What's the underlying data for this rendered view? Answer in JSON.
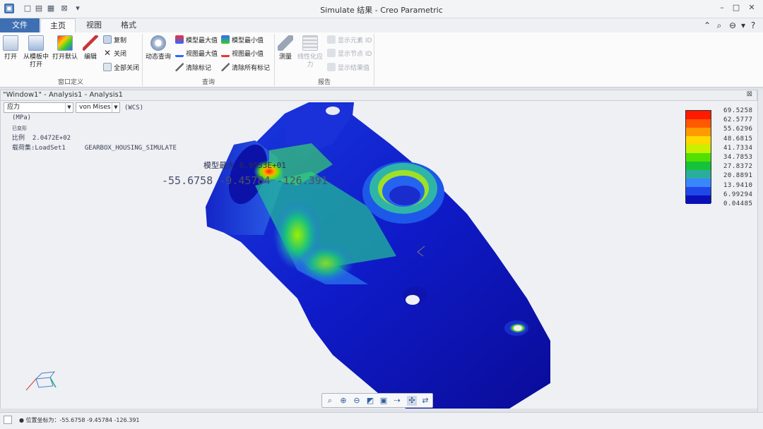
{
  "window": {
    "title": "Simulate 结果 - Creo Parametric"
  },
  "quick_access": [
    "app-icon",
    "new-icon",
    "open-icon",
    "save-icon",
    "print-icon",
    "close-window-icon",
    "customize-icon"
  ],
  "tabs": [
    {
      "label": "文件"
    },
    {
      "label": "主页"
    },
    {
      "label": "视图"
    },
    {
      "label": "格式"
    }
  ],
  "ribbon": {
    "window_group": {
      "open": "打开",
      "open_from_template": "从模板中打开",
      "open_default": "打开默认",
      "edit": "编辑",
      "copy": "复制",
      "close": "关闭",
      "close_all": "全部关闭",
      "label": "窗口定义"
    },
    "query_group": {
      "dynamic_query": "动态查询",
      "model_max": "模型最大值",
      "model_min": "模型最小值",
      "view_max": "视图最大值",
      "view_min": "视图最小值",
      "clear_marks": "清除标记",
      "clear_all_marks": "清除所有标记",
      "label": "查询"
    },
    "report_group": {
      "measure": "测量",
      "linearize": "线性化应力",
      "show_element_id": "显示元素 ID",
      "show_node_id": "显示节点 ID",
      "show_result_value": "显示结果值",
      "label": "报告"
    }
  },
  "subwindow": {
    "title": "\"Window1\" - Analysis1 - Analysis1"
  },
  "result_controls": {
    "quantity": "应力",
    "component": "von Mises",
    "coord_system": "(WCS)"
  },
  "info": {
    "units": "(MPa)",
    "deformed": "已变形",
    "scale_label": "比例",
    "scale_value": "2.0472E+02",
    "loadset_label": "载荷集:",
    "loadset_value": "LoadSet1",
    "model_name": "GEARBOX_HOUSING_SIMULATE"
  },
  "query_readout": {
    "label": "模型最大",
    "value": "6.9553E+01",
    "coords": "-55.6758  -9.45784  -126.391"
  },
  "legend": {
    "values": [
      "69.5258",
      "62.5777",
      "55.6296",
      "48.6815",
      "41.7334",
      "34.7853",
      "27.8372",
      "20.8891",
      "13.9410",
      "6.99294",
      "0.04485"
    ],
    "colors": [
      "#ff1a00",
      "#ff5a00",
      "#ff9a00",
      "#ffd800",
      "#c8f000",
      "#52e000",
      "#16c23a",
      "#2aae9c",
      "#3a86ff",
      "#1f48e8",
      "#0b0fb8"
    ]
  },
  "zoom_toolbar": [
    "refit-icon",
    "zoom-in-icon",
    "zoom-out-icon",
    "repaint-icon",
    "saved-views-icon",
    "display-style-icon",
    "spin-center-icon",
    "annotation-display-icon"
  ],
  "status": {
    "text": "● 位置坐标为：-55.6758  -9.45784  -126.391"
  },
  "colors": {
    "file_tab": "#3f6fb3",
    "viewport_bg": "#eef0f4"
  }
}
